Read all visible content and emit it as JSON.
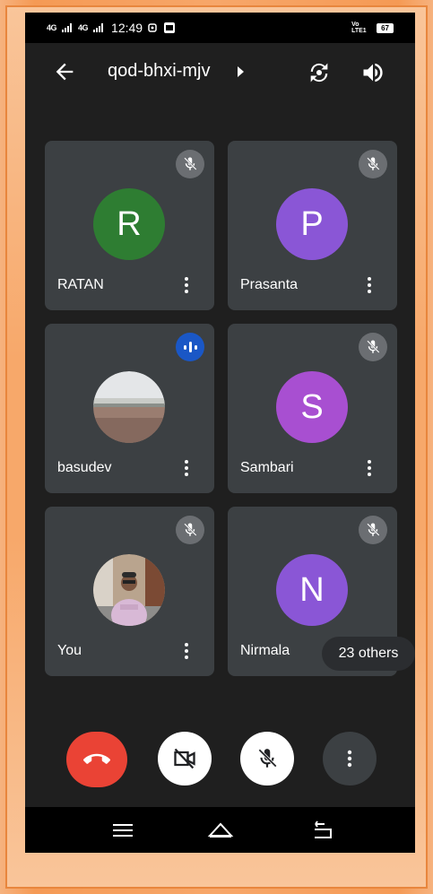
{
  "status_bar": {
    "signal_1": "4G",
    "signal_2": "4G",
    "time": "12:49",
    "volte": "Vo LTE1 LTE2",
    "battery": "67"
  },
  "header": {
    "meeting_code": "qod-bhxi-mjv"
  },
  "participants": [
    {
      "name": "RATAN",
      "initial": "R",
      "avatar_color": "#2e7d32",
      "muted": true
    },
    {
      "name": "Prasanta",
      "initial": "P",
      "avatar_color": "#8a56d6",
      "muted": true
    },
    {
      "name": "basudev",
      "initial": "",
      "avatar_type": "photo-landscape",
      "muted": false,
      "speaking": true
    },
    {
      "name": "Sambari",
      "initial": "S",
      "avatar_color": "#a84fd1",
      "muted": true
    },
    {
      "name": "You",
      "initial": "",
      "avatar_type": "photo-person",
      "muted": true
    },
    {
      "name": "Nirmala",
      "initial": "N",
      "avatar_color": "#8a56d6",
      "muted": true
    }
  ],
  "others_chip": "23 others",
  "controls": {
    "end_call_color": "#ea4335",
    "icons": [
      "end-call-icon",
      "camera-off-icon",
      "mic-off-icon",
      "more-vertical-icon"
    ]
  },
  "colors": {
    "tile_bg": "#3c4043",
    "app_bg": "#1f1f1f",
    "speaking_blue": "#1a57c6"
  }
}
